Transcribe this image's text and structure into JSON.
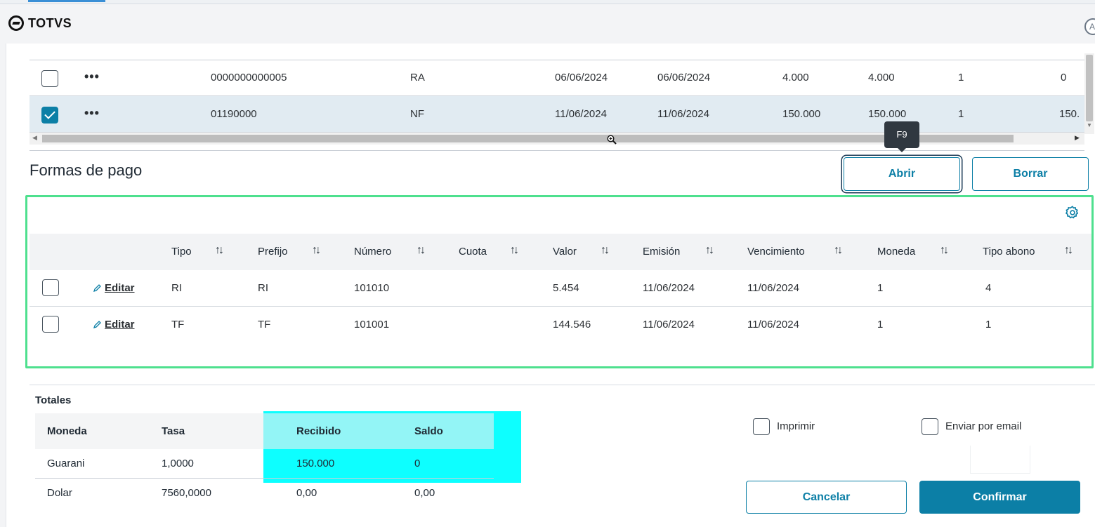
{
  "app": {
    "brand": "TOTVS"
  },
  "top_grid": {
    "rows": [
      {
        "checked": false,
        "menu": "•••",
        "numero": "0000000000005",
        "tipo": "RA",
        "emision": "06/06/2024",
        "vencimiento": "06/06/2024",
        "valor": "4.000",
        "saldo": "4.000",
        "moneda": "1",
        "extra": "0"
      },
      {
        "checked": true,
        "menu": "•••",
        "numero": "01190000",
        "tipo": "NF",
        "emision": "11/06/2024",
        "vencimiento": "11/06/2024",
        "valor": "150.000",
        "saldo": "150.000",
        "moneda": "1",
        "extra": "150."
      }
    ]
  },
  "formas_de_pago": {
    "title": "Formas de pago",
    "tooltip": "F9",
    "buttons": {
      "abrir": "Abrir",
      "borrar": "Borrar"
    },
    "columns": [
      "Tipo",
      "Prefijo",
      "Número",
      "Cuota",
      "Valor",
      "Emisión",
      "Vencimiento",
      "Moneda",
      "Tipo abono"
    ],
    "edit_label": "Editar",
    "rows": [
      {
        "tipo": "RI",
        "prefijo": "RI",
        "numero": "101010",
        "cuota": "",
        "valor": "5.454",
        "emision": "11/06/2024",
        "vencimiento": "11/06/2024",
        "moneda": "1",
        "tipo_abono": "4"
      },
      {
        "tipo": "TF",
        "prefijo": "TF",
        "numero": "101001",
        "cuota": "",
        "valor": "144.546",
        "emision": "11/06/2024",
        "vencimiento": "11/06/2024",
        "moneda": "1",
        "tipo_abono": "1"
      }
    ]
  },
  "totales": {
    "title": "Totales",
    "columns": [
      "Moneda",
      "Tasa",
      "Recibido",
      "Saldo"
    ],
    "rows": [
      {
        "moneda": "Guarani",
        "tasa": "1,0000",
        "recibido": "150.000",
        "saldo": "0"
      },
      {
        "moneda": "Dolar",
        "tasa": "7560,0000",
        "recibido": "0,00",
        "saldo": "0,00"
      }
    ]
  },
  "options": {
    "imprimir": "Imprimir",
    "enviar_email": "Enviar por email"
  },
  "actions": {
    "cancelar": "Cancelar",
    "confirmar": "Confirmar"
  },
  "colors": {
    "primary": "#0c7fa6",
    "highlight_green": "#4ee08e",
    "highlight_cyan": "#00ffff",
    "selected_row": "#e1ebf2"
  }
}
